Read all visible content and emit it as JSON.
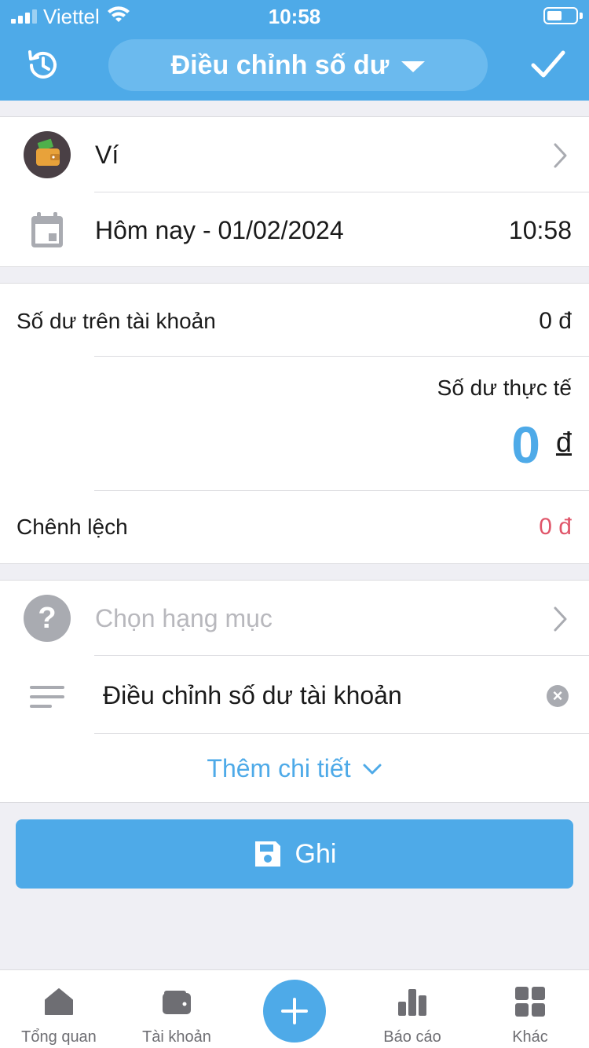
{
  "status_bar": {
    "carrier": "Viettel",
    "time": "10:58"
  },
  "header": {
    "title": "Điều chỉnh số dư"
  },
  "account": {
    "name": "Ví",
    "date_label": "Hôm nay - 01/02/2024",
    "time": "10:58"
  },
  "balances": {
    "account_balance_label": "Số dư trên tài khoản",
    "account_balance_value": "0 đ",
    "actual_balance_label": "Số dư thực tế",
    "actual_balance_value": "0",
    "actual_balance_currency": "đ",
    "difference_label": "Chênh lệch",
    "difference_value": "0 đ"
  },
  "details": {
    "category_placeholder": "Chọn hạng mục",
    "note": "Điều chỉnh số dư tài khoản",
    "more_details": "Thêm chi tiết"
  },
  "save_button": {
    "label": "Ghi"
  },
  "tabbar": {
    "items": [
      {
        "label": "Tổng quan",
        "icon": "home-icon"
      },
      {
        "label": "Tài khoản",
        "icon": "wallet-icon"
      },
      {
        "label": "",
        "icon": "plus-icon"
      },
      {
        "label": "Báo cáo",
        "icon": "bar-chart-icon"
      },
      {
        "label": "Khác",
        "icon": "grid-icon"
      }
    ]
  },
  "colors": {
    "accent": "#4eaae8",
    "negative": "#e0566a",
    "text": "#1a1a1a",
    "muted": "#a9abb1"
  }
}
